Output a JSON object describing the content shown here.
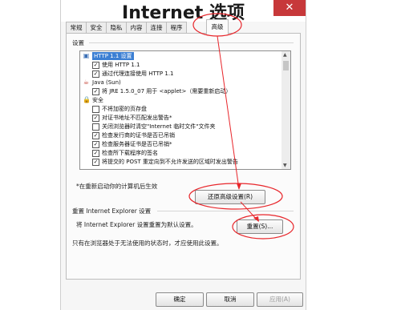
{
  "window": {
    "title": "Internet 选项",
    "close_glyph": "✕"
  },
  "tabs": [
    "常规",
    "安全",
    "隐私",
    "内容",
    "连接",
    "程序",
    "高级"
  ],
  "active_tab": "高级",
  "settings_group": {
    "title": "设置",
    "items": [
      {
        "type": "header",
        "icon": "settings-folder-icon",
        "label": "HTTP 1.1 设置",
        "selected": true
      },
      {
        "type": "checkbox",
        "checked": true,
        "label": "使用 HTTP 1.1"
      },
      {
        "type": "checkbox",
        "checked": true,
        "label": "通过代理连接使用 HTTP 1.1"
      },
      {
        "type": "header",
        "icon": "java-icon",
        "label": "Java (Sun)"
      },
      {
        "type": "checkbox",
        "checked": true,
        "label": "将 JRE 1.5.0_07 用于 <applet>（需要重新启动）"
      },
      {
        "type": "header",
        "icon": "lock-icon",
        "label": "安全"
      },
      {
        "type": "checkbox",
        "checked": false,
        "label": "不将加密的页存盘"
      },
      {
        "type": "checkbox",
        "checked": true,
        "label": "对证书地址不匹配发出警告*"
      },
      {
        "type": "checkbox",
        "checked": false,
        "label": "关闭浏览器时清空\"Internet 临时文件\"文件夹"
      },
      {
        "type": "checkbox",
        "checked": true,
        "label": "检查发行商的证书是否已吊销"
      },
      {
        "type": "checkbox",
        "checked": true,
        "label": "检查服务器证书是否已吊销*"
      },
      {
        "type": "checkbox",
        "checked": true,
        "label": "检查所下载程序的签名"
      },
      {
        "type": "checkbox",
        "checked": true,
        "label": "将提交的 POST 重定向到不允许发送的区域时发出警告"
      }
    ],
    "restart_note": "*在重新启动你的计算机后生效",
    "restore_button": "还原高级设置(R)"
  },
  "reset_group": {
    "title": "重置 Internet Explorer 设置",
    "description": "将 Internet Explorer 设置重置为默认设置。",
    "reset_button": "重置(S)...",
    "note": "只有在浏览器处于无法使用的状态时，才应使用此设置。"
  },
  "footer": {
    "ok": "确定",
    "cancel": "取消",
    "apply": "应用(A)"
  },
  "annotation": {
    "color": "#e8262b"
  }
}
